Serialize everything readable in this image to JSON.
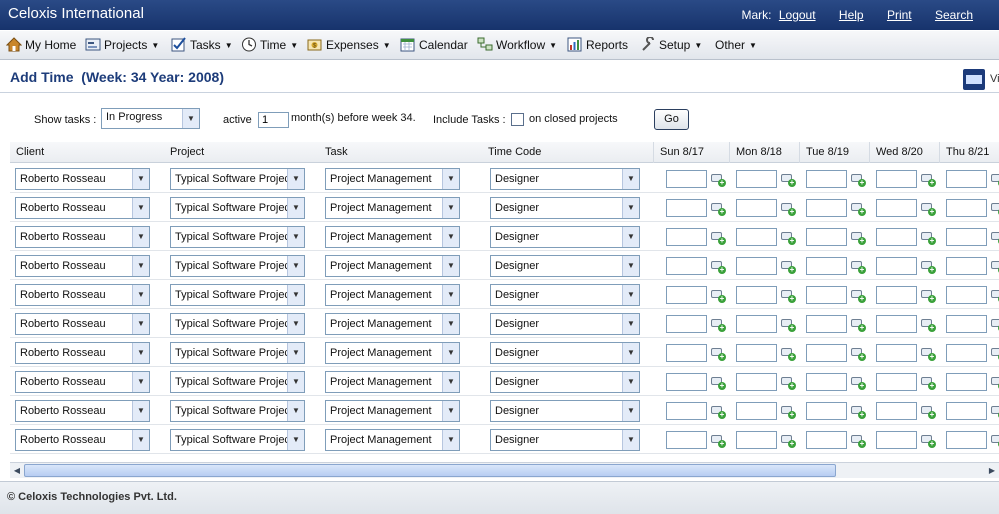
{
  "header": {
    "app_title": "Celoxis International",
    "user_label": "Mark:",
    "logout": "Logout",
    "help": "Help",
    "print": "Print",
    "search": "Search"
  },
  "menu": [
    {
      "label": "My Home",
      "icon": "home-icon",
      "dropdown": false
    },
    {
      "label": "Projects",
      "icon": "projects-icon",
      "dropdown": true
    },
    {
      "label": "Tasks",
      "icon": "tasks-checkmark-icon",
      "dropdown": true
    },
    {
      "label": "Time",
      "icon": "clock-icon",
      "dropdown": true
    },
    {
      "label": "Expenses",
      "icon": "expenses-icon",
      "dropdown": true
    },
    {
      "label": "Calendar",
      "icon": "calendar-icon",
      "dropdown": false
    },
    {
      "label": "Workflow",
      "icon": "workflow-icon",
      "dropdown": true
    },
    {
      "label": "Reports",
      "icon": "reports-icon",
      "dropdown": false
    },
    {
      "label": "Setup",
      "icon": "wrench-icon",
      "dropdown": true
    },
    {
      "label": "Other",
      "icon": "",
      "dropdown": true
    }
  ],
  "page": {
    "title": "Add Time  (Week: 34 Year: 2008)",
    "video_label": "Vi"
  },
  "filters": {
    "show_tasks_label": "Show tasks :",
    "status_value": "In Progress",
    "active_label": "active",
    "months_value": "1",
    "months_label": "month(s) before week 34.",
    "include_label": "Include Tasks :",
    "closed_label": "on closed projects",
    "go_label": "Go"
  },
  "table": {
    "columns": [
      "Client",
      "Project",
      "Task",
      "Time Code",
      "Sun 8/17",
      "Mon 8/18",
      "Tue 8/19",
      "Wed 8/20",
      "Thu 8/21"
    ],
    "rows": [
      {
        "client": "Roberto Rosseau",
        "project": "Typical Software Project",
        "task": "Project Management",
        "time_code": "Designer"
      },
      {
        "client": "Roberto Rosseau",
        "project": "Typical Software Project",
        "task": "Project Management",
        "time_code": "Designer"
      },
      {
        "client": "Roberto Rosseau",
        "project": "Typical Software Project",
        "task": "Project Management",
        "time_code": "Designer"
      },
      {
        "client": "Roberto Rosseau",
        "project": "Typical Software Project",
        "task": "Project Management",
        "time_code": "Designer"
      },
      {
        "client": "Roberto Rosseau",
        "project": "Typical Software Project",
        "task": "Project Management",
        "time_code": "Designer"
      },
      {
        "client": "Roberto Rosseau",
        "project": "Typical Software Project",
        "task": "Project Management",
        "time_code": "Designer"
      },
      {
        "client": "Roberto Rosseau",
        "project": "Typical Software Project",
        "task": "Project Management",
        "time_code": "Designer"
      },
      {
        "client": "Roberto Rosseau",
        "project": "Typical Software Project",
        "task": "Project Management",
        "time_code": "Designer"
      },
      {
        "client": "Roberto Rosseau",
        "project": "Typical Software Project",
        "task": "Project Management",
        "time_code": "Designer"
      },
      {
        "client": "Roberto Rosseau",
        "project": "Typical Software Project",
        "task": "Project Management",
        "time_code": "Designer"
      }
    ]
  },
  "footer": {
    "copyright": "© Celoxis Technologies Pvt. Ltd."
  },
  "colors": {
    "header_bg": "#1f3c78",
    "heading_text": "#1d3c7a",
    "scroll_thumb": "#c5d8f6"
  }
}
